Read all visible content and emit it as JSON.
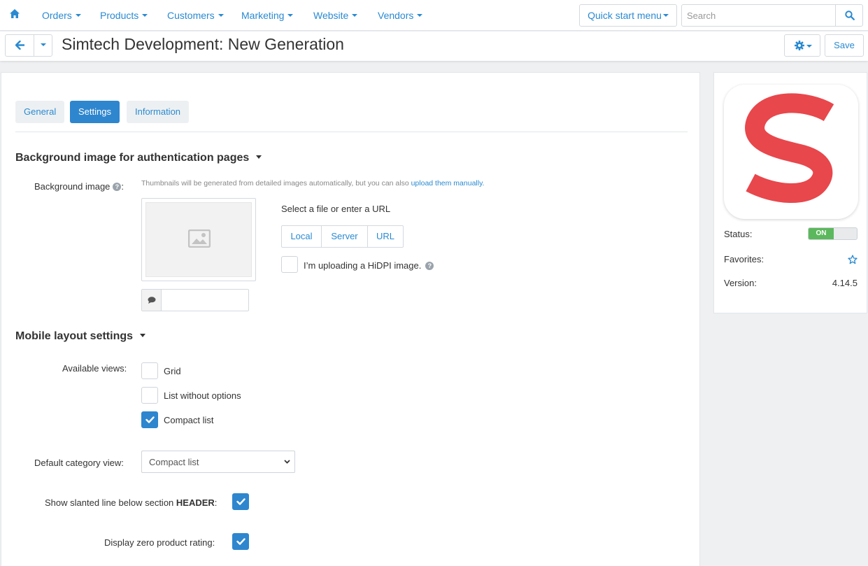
{
  "nav": {
    "items": [
      {
        "label": "Orders"
      },
      {
        "label": "Products"
      },
      {
        "label": "Customers"
      },
      {
        "label": "Marketing"
      },
      {
        "label": "Website"
      },
      {
        "label": "Vendors"
      }
    ],
    "quick_start_label": "Quick start menu",
    "search_placeholder": "Search"
  },
  "header": {
    "title": "Simtech Development: New Generation",
    "save_label": "Save"
  },
  "tabs": [
    {
      "label": "General",
      "active": false
    },
    {
      "label": "Settings",
      "active": true
    },
    {
      "label": "Information",
      "active": false
    }
  ],
  "bg_section": {
    "title": "Background image for authentication pages",
    "field_label": "Background image",
    "hint_text": "Thumbnails will be generated from detailed images automatically, but you can also ",
    "hint_link": "upload them manually.",
    "select_text": "Select a file or enter a URL",
    "sources": [
      "Local",
      "Server",
      "URL"
    ],
    "hidpi_label": "I’m uploading a HiDPI image.",
    "hidpi_checked": false,
    "alt_text_value": ""
  },
  "mobile_section": {
    "title": "Mobile layout settings",
    "available_views_label": "Available views:",
    "views": [
      {
        "label": "Grid",
        "checked": false
      },
      {
        "label": "List without options",
        "checked": false
      },
      {
        "label": "Compact list",
        "checked": true
      }
    ],
    "default_view_label": "Default category view:",
    "default_view_value": "Compact list",
    "slanted_label_prefix": "Show slanted line below section ",
    "slanted_label_bold": "HEADER",
    "slanted_label_suffix": ":",
    "slanted_checked": true,
    "zero_rating_label": "Display zero product rating:",
    "zero_rating_checked": true
  },
  "sidebar": {
    "status_label": "Status:",
    "status_value": "ON",
    "favorites_label": "Favorites:",
    "version_label": "Version:",
    "version_value": "4.14.5"
  },
  "colors": {
    "accent": "#2a8ad1",
    "logo_red": "#e8474c",
    "status_on": "#5cb85c"
  }
}
